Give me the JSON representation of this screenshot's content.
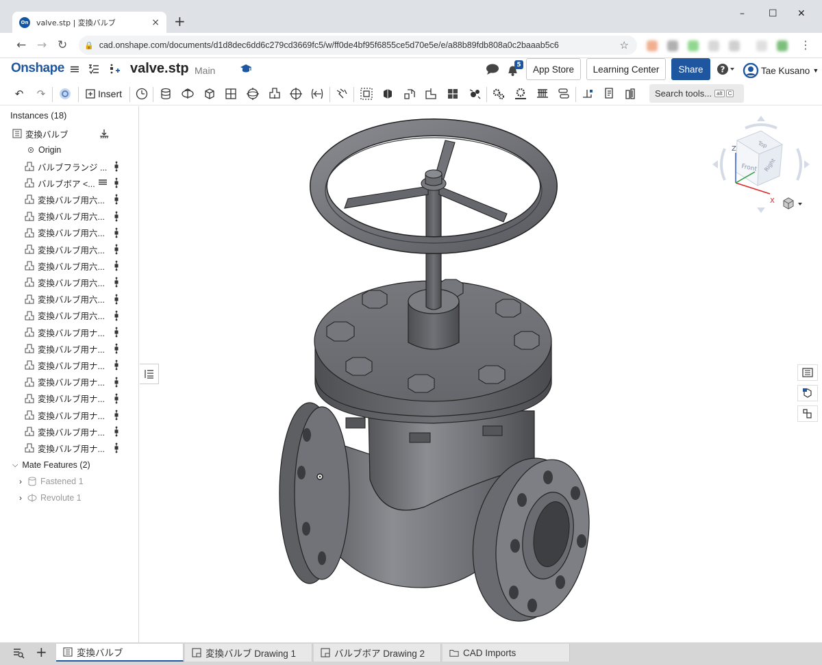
{
  "browser": {
    "tab_title": "valve.stp | 変換バルブ",
    "favicon_text": "On",
    "url": "cad.onshape.com/documents/d1d8dec6dd6c279cd3669fc5/w/ff0de4bf95f6855ce5d70e5e/e/a88b89fdb808a0c2baaab5c6",
    "new_tab": "+",
    "close_tab": "×",
    "minimize": "–",
    "maximize": "☐",
    "close_window": "✕"
  },
  "header": {
    "logo": "Onshape",
    "doc_title": "valve.stp",
    "workspace": "Main",
    "notification_count": "5",
    "app_store": "App Store",
    "learning_center": "Learning Center",
    "share": "Share",
    "user_name": "Tae Kusano"
  },
  "toolbar": {
    "insert_label": "Insert",
    "search_placeholder": "Search tools...",
    "shortcut_keys": [
      "alt",
      "C"
    ]
  },
  "instances": {
    "heading": "Instances (18)",
    "assembly_name": "変換バルブ",
    "origin_label": "Origin",
    "parts": [
      "バルブフランジ ...",
      "バルブボア <...",
      "変換バルブ用六...",
      "変換バルブ用六...",
      "変換バルブ用六...",
      "変換バルブ用六...",
      "変換バルブ用六...",
      "変換バルブ用六...",
      "変換バルブ用六...",
      "変換バルブ用六...",
      "変換バルブ用ナ...",
      "変換バルブ用ナ...",
      "変換バルブ用ナ...",
      "変換バルブ用ナ...",
      "変換バルブ用ナ...",
      "変換バルブ用ナ...",
      "変換バルブ用ナ...",
      "変換バルブ用ナ..."
    ]
  },
  "mates": {
    "heading": "Mate Features (2)",
    "items": [
      "Fastened 1",
      "Revolute 1"
    ]
  },
  "view_cube": {
    "top": "Top",
    "front": "Front",
    "right": "Right",
    "axis_z": "Z",
    "axis_x": "X"
  },
  "bottom_tabs": [
    {
      "label": "変換バルブ",
      "active": true
    },
    {
      "label": "変換バルブ Drawing 1",
      "active": false
    },
    {
      "label": "バルブボア Drawing 2",
      "active": false
    },
    {
      "label": "CAD Imports",
      "active": false
    }
  ],
  "colors": {
    "brand": "#1e56a0",
    "part_gray": "#6b6b6f"
  }
}
